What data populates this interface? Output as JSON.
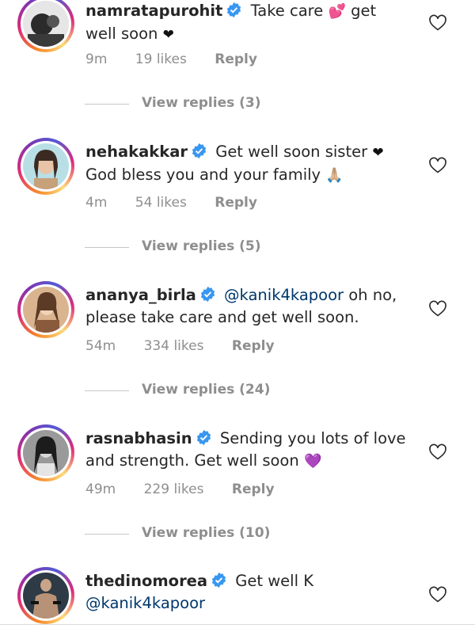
{
  "comments": [
    {
      "username": "namratapurohit",
      "text": "Take care",
      "emoji_1": "💕",
      "text_2": "get well soon",
      "emoji_2": "❤",
      "time": "9m",
      "likes": "19 likes",
      "reply_label": "Reply",
      "view_replies": "View replies (3)"
    },
    {
      "username": "nehakakkar",
      "text": "Get well soon sister",
      "emoji_1": "❤",
      "text_2": "God bless you and your family",
      "emoji_2": "🙏🏼",
      "time": "4m",
      "likes": "54 likes",
      "reply_label": "Reply",
      "view_replies": "View replies (5)"
    },
    {
      "username": "ananya_birla",
      "mention": "@kanik4kapoor",
      "text": "oh no, please take care and get well soon.",
      "time": "54m",
      "likes": "334 likes",
      "reply_label": "Reply",
      "view_replies": "View replies (24)"
    },
    {
      "username": "rasnabhasin",
      "text": "Sending you lots of love and strength. Get well soon",
      "emoji_1": "💜",
      "time": "49m",
      "likes": "229 likes",
      "reply_label": "Reply",
      "view_replies": "View replies (10)"
    },
    {
      "username": "thedinomorea",
      "text": "Get well K",
      "mention": "@kanik4kapoor"
    }
  ],
  "icons": {
    "verified": "verified-badge-icon",
    "like": "heart-outline-icon"
  },
  "colors": {
    "verified": "#3897f0",
    "meta": "#8e8e8e",
    "mention": "#00376b",
    "heart_purple": "#8e44ad"
  }
}
